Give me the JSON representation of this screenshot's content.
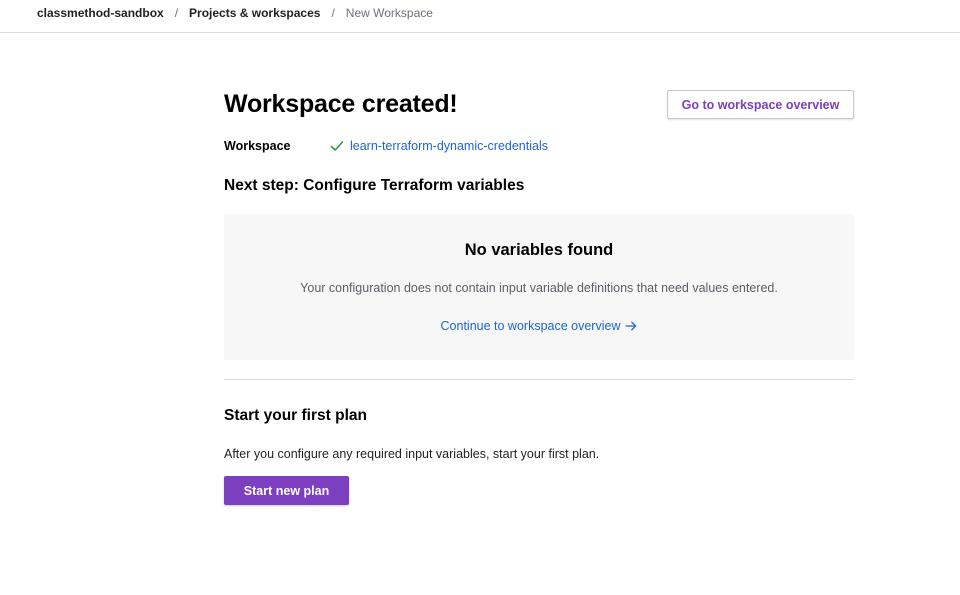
{
  "breadcrumb": {
    "org": "classmethod-sandbox",
    "section": "Projects & workspaces",
    "current": "New Workspace",
    "separator": "/"
  },
  "header": {
    "title": "Workspace created!",
    "overview_button": "Go to workspace overview"
  },
  "workspace": {
    "label": "Workspace",
    "name": "learn-terraform-dynamic-credentials",
    "status_icon": "check-icon"
  },
  "variables": {
    "heading": "Next step: Configure Terraform variables",
    "empty_title": "No variables found",
    "empty_description": "Your configuration does not contain input variable definitions that need values entered.",
    "continue_link": "Continue to workspace overview"
  },
  "plan": {
    "heading": "Start your first plan",
    "description": "After you configure any required input variables, start your first plan.",
    "button": "Start new plan"
  },
  "colors": {
    "accent": "#7b3fbf",
    "link": "#1f64d1",
    "success": "#2f9e44",
    "panel_bg": "#f7f7f8"
  }
}
